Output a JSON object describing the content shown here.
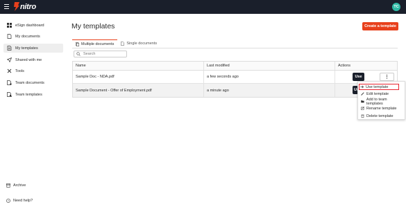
{
  "brand": {
    "logo_text": "nitro",
    "logo_color": "#e8401c"
  },
  "user": {
    "initials": "TC",
    "avatar_color": "#2fb9a5"
  },
  "sidebar": {
    "items": [
      {
        "label": "eSign dashboard",
        "icon": "dashboard-icon"
      },
      {
        "label": "My documents",
        "icon": "document-icon"
      },
      {
        "label": "My templates",
        "icon": "template-icon",
        "active": true
      },
      {
        "label": "Shared with me",
        "icon": "send-icon"
      },
      {
        "label": "Tools",
        "icon": "tools-icon"
      },
      {
        "label": "Team documents",
        "icon": "team-document-icon"
      },
      {
        "label": "Team templates",
        "icon": "team-template-icon"
      }
    ],
    "footer": [
      {
        "label": "Archive",
        "icon": "archive-icon"
      },
      {
        "label": "Need help?",
        "icon": "help-icon"
      }
    ]
  },
  "main": {
    "title": "My templates",
    "create_button": "Create a template",
    "tabs": [
      {
        "label": "Multiple documents",
        "active": true
      },
      {
        "label": "Single documents",
        "active": false
      }
    ],
    "search": {
      "placeholder": "Search",
      "value": ""
    },
    "table": {
      "headers": [
        "Name",
        "Last modified",
        "Actions"
      ],
      "rows": [
        {
          "name": "Sample Doc - NDA.pdf",
          "modified": "a few seconds ago",
          "use": "Use"
        },
        {
          "name": "Sample Document - Offer of Employment.pdf",
          "modified": "a minute ago",
          "use": "Use"
        }
      ],
      "kebab": "⋮"
    }
  },
  "menu": {
    "items": [
      {
        "label": "Use template",
        "icon": "arrow-right-icon",
        "highlighted": true
      },
      {
        "label": "Edit template",
        "icon": "pencil-icon"
      },
      {
        "label": "Add to team templates",
        "icon": "folder-icon"
      },
      {
        "label": "Rename template",
        "icon": "edit-box-icon"
      },
      {
        "label": "Delete template",
        "icon": "trash-icon"
      }
    ]
  },
  "colors": {
    "accent": "#e8401c",
    "topbar": "#1a1f2b",
    "highlight_border": "#e8242f"
  }
}
